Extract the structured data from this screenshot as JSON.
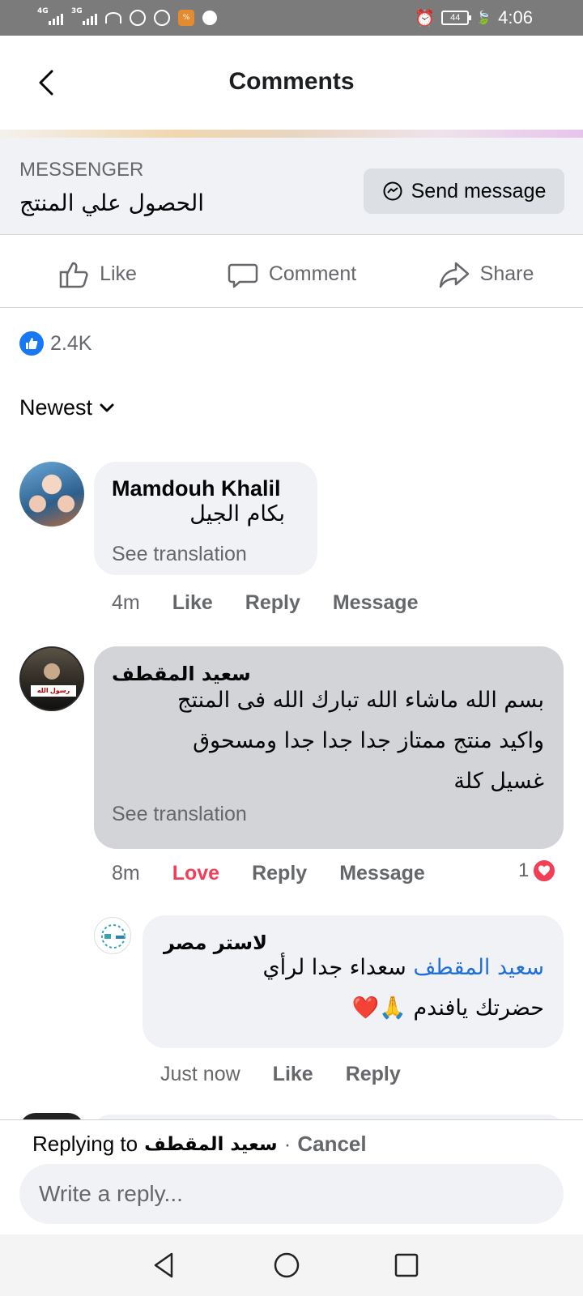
{
  "status_bar": {
    "net1": "4G",
    "net2": "3G",
    "battery": "44",
    "time": "4:06"
  },
  "header": {
    "title": "Comments"
  },
  "messenger": {
    "label": "MESSENGER",
    "text": "الحصول علي المنتج",
    "send_button": "Send message"
  },
  "actions": {
    "like": "Like",
    "comment": "Comment",
    "share": "Share"
  },
  "reactions": {
    "count": "2.4K"
  },
  "sort": {
    "label": "Newest"
  },
  "comments": [
    {
      "author": "Mamdouh Khalil",
      "text": "بكام الجيل",
      "see_translation": "See translation",
      "time": "4m",
      "like": "Like",
      "reply": "Reply",
      "message": "Message"
    },
    {
      "author": "سعيد المقطف",
      "text_lines": [
        "بسم الله ماشاء الله تبارك الله فى المنتج",
        "واكيد منتج ممتاز جدا جدا جدا ومسحوق",
        "غسيل كلة"
      ],
      "see_translation": "See translation",
      "time": "8m",
      "love": "Love",
      "reply": "Reply",
      "message": "Message",
      "reaction_count": "1",
      "avatar_caption": "رسول الله"
    }
  ],
  "reply": {
    "author": "لاستر مصر",
    "mention": "سعيد المقطف",
    "line1_rest": "سعداء جدا لرأي",
    "line2": "حضرتك يافندم 🙏❤️",
    "time": "Just now",
    "like": "Like",
    "reply": "Reply"
  },
  "composer": {
    "replying_to": "Replying to",
    "replying_name": "سعيد المقطف",
    "separator": "·",
    "cancel": "Cancel",
    "placeholder": "Write a reply..."
  },
  "colors": {
    "facebook_blue": "#1877f2",
    "love_red": "#f33e58",
    "bubble_gray": "#f0f2f5",
    "secondary_text": "#65676b"
  }
}
